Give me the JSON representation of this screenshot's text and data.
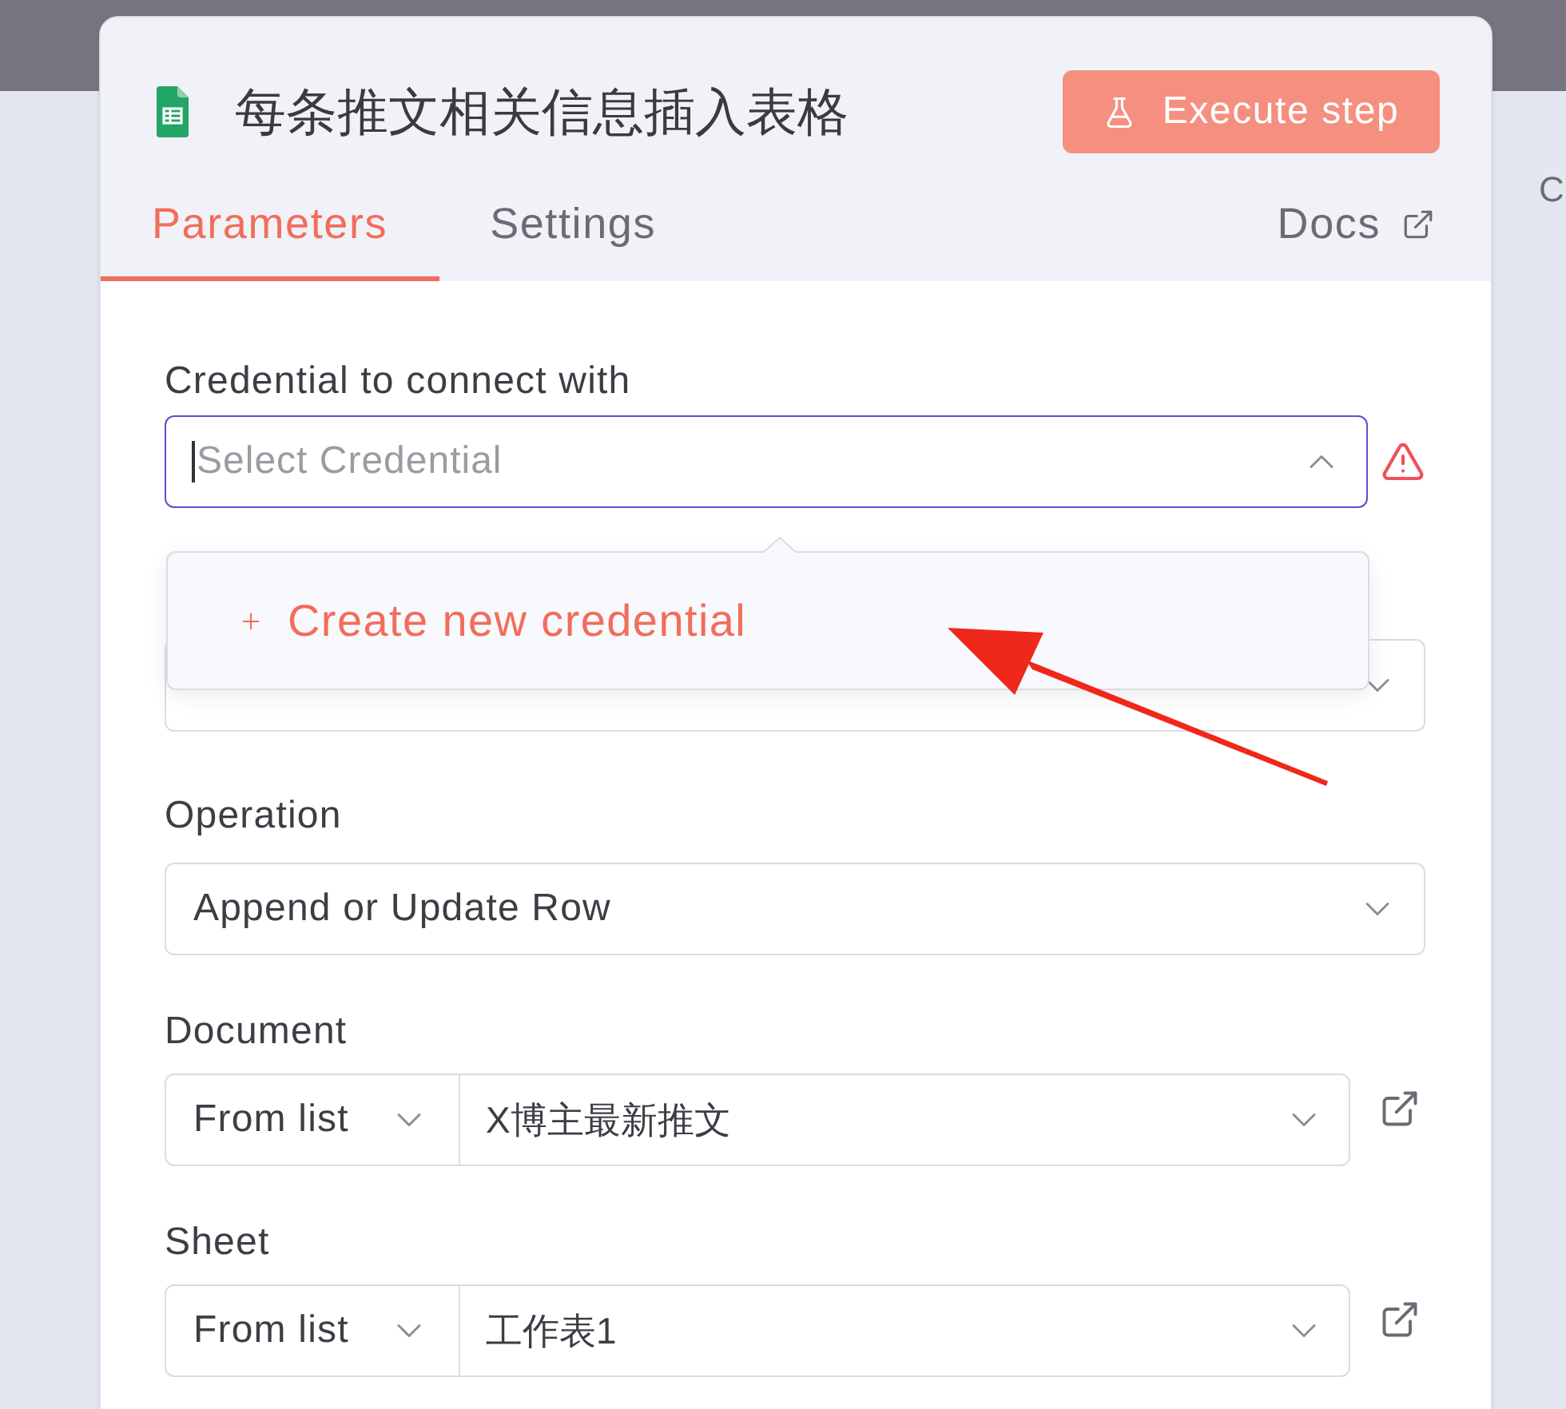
{
  "backdrop": {
    "edge_text": "C"
  },
  "node": {
    "title": "每条推文相关信息插入表格",
    "execute_button": {
      "label": "Execute step",
      "disabled": true
    }
  },
  "tabs": [
    {
      "label": "Parameters",
      "selected": true
    },
    {
      "label": "Settings",
      "selected": false
    }
  ],
  "docs_link": {
    "label": "Docs"
  },
  "fields": [
    {
      "kind": "credential",
      "label": "Credential to connect with",
      "placeholder": "Select Credential",
      "expanded": true,
      "warning": true,
      "menu": [
        {
          "label": "Create new credential"
        }
      ]
    },
    {
      "kind": "select"
    },
    {
      "kind": "select",
      "label": "Operation",
      "value": "Append or Update Row"
    },
    {
      "kind": "resource",
      "label": "Document",
      "mode": "From list",
      "value": "X博主最新推文"
    },
    {
      "kind": "resource",
      "label": "Sheet",
      "mode": "From list",
      "value": "工作表1"
    }
  ]
}
